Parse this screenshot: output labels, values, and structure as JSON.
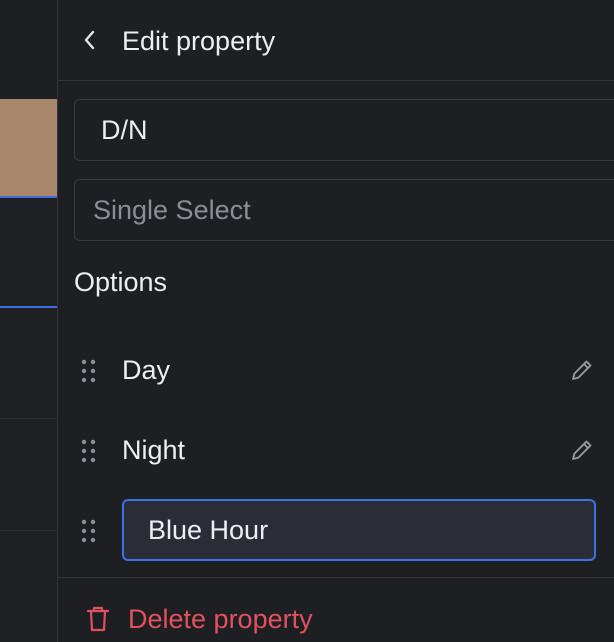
{
  "header": {
    "title": "Edit property"
  },
  "property": {
    "name_value": "D/N",
    "type_label": "Single Select"
  },
  "options": {
    "section_label": "Options",
    "items": [
      {
        "label": "Day"
      },
      {
        "label": "Night"
      }
    ],
    "editing_value": "Blue Hour"
  },
  "footer": {
    "delete_label": "Delete property"
  },
  "colors": {
    "accent_blue": "#3b72e6",
    "danger_red": "#e0525d",
    "swatch_tan": "#a8876d"
  }
}
